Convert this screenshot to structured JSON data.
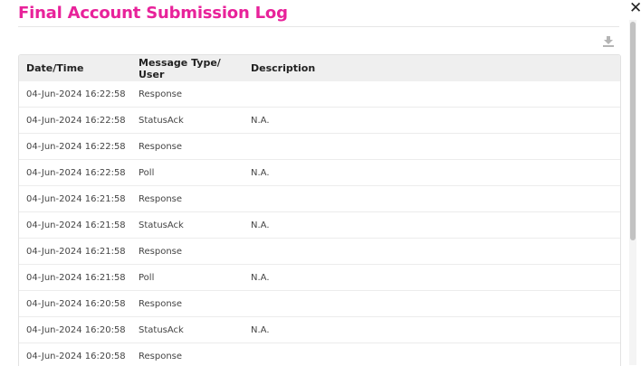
{
  "dialog": {
    "title": "Final Account Submission Log",
    "close_label": "✕",
    "download_icon": "download-icon"
  },
  "table": {
    "headers": [
      "Date/Time",
      "Message Type/ User",
      "Description"
    ],
    "rows": [
      {
        "datetime": "04-Jun-2024 16:22:58",
        "type": "Response",
        "description": ""
      },
      {
        "datetime": "04-Jun-2024 16:22:58",
        "type": "StatusAck",
        "description": "N.A."
      },
      {
        "datetime": "04-Jun-2024 16:22:58",
        "type": "Response",
        "description": ""
      },
      {
        "datetime": "04-Jun-2024 16:22:58",
        "type": "Poll",
        "description": "N.A."
      },
      {
        "datetime": "04-Jun-2024 16:21:58",
        "type": "Response",
        "description": ""
      },
      {
        "datetime": "04-Jun-2024 16:21:58",
        "type": "StatusAck",
        "description": "N.A."
      },
      {
        "datetime": "04-Jun-2024 16:21:58",
        "type": "Response",
        "description": ""
      },
      {
        "datetime": "04-Jun-2024 16:21:58",
        "type": "Poll",
        "description": "N.A."
      },
      {
        "datetime": "04-Jun-2024 16:20:58",
        "type": "Response",
        "description": ""
      },
      {
        "datetime": "04-Jun-2024 16:20:58",
        "type": "StatusAck",
        "description": "N.A."
      },
      {
        "datetime": "04-Jun-2024 16:20:58",
        "type": "Response",
        "description": ""
      }
    ]
  },
  "colors": {
    "title": "#e8229a",
    "header_bg": "#efefef",
    "row_border": "#ececec"
  }
}
